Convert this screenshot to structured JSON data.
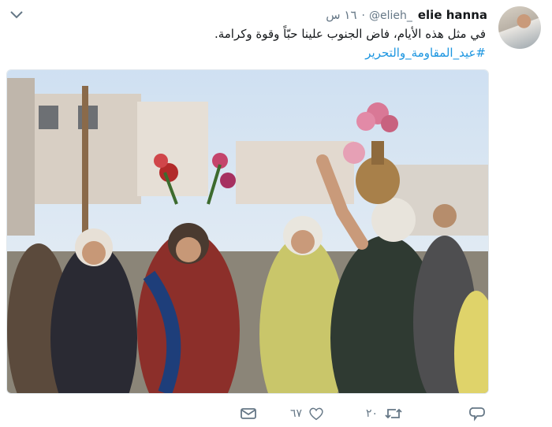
{
  "tweet": {
    "author_name": "elie hanna",
    "author_handle": "@elieh_",
    "time": "١٦ س",
    "text": "في مثل هذه الأيام، فاض الجنوب علينا حبّاً وقوة وكرامة.",
    "hashtag": "#عيد_المقاومة_والتحرير"
  },
  "actions": {
    "retweets": "٢٠",
    "likes": "٦٧"
  },
  "colors": {
    "link": "#1b95e0",
    "muted": "#657786",
    "text": "#14171a"
  }
}
